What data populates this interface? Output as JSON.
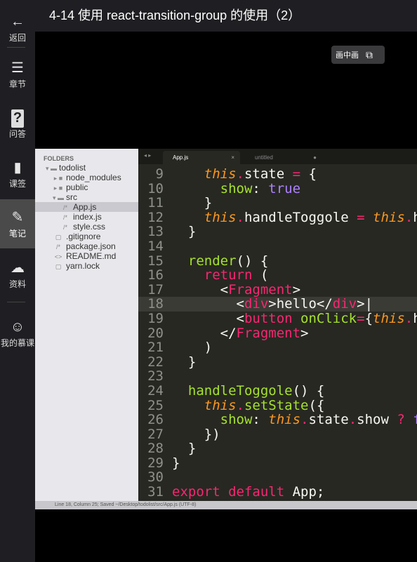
{
  "title": "4-14 使用 react-transition-group 的使用（2）",
  "pip_label": "画中画",
  "sidebar": [
    {
      "label": "返回",
      "icon": "back-arrow-icon",
      "glyph": "←"
    },
    {
      "label": "章节",
      "icon": "menu-icon",
      "glyph": "☰"
    },
    {
      "label": "问答",
      "icon": "question-icon",
      "glyph": "?"
    },
    {
      "label": "课签",
      "icon": "bookmark-icon",
      "glyph": "▮"
    },
    {
      "label": "笔记",
      "icon": "pencil-icon",
      "glyph": "✎"
    },
    {
      "label": "资料",
      "icon": "cloud-download-icon",
      "glyph": "☁"
    },
    {
      "label": "我的慕课",
      "icon": "avatar-icon",
      "glyph": "☺"
    }
  ],
  "editor": {
    "folders_label": "FOLDERS",
    "tree": [
      "todolist",
      "node_modules",
      "public",
      "src",
      "App.js",
      "index.js",
      "style.css",
      ".gitignore",
      "package.json",
      "README.md",
      "yarn.lock"
    ],
    "tabs": [
      "App.js",
      "untitled"
    ],
    "status": "Line 18, Column 25; Saved ~/Desktop/todolist/src/App.js (UTF-8)",
    "lines": [
      {
        "n": "9",
        "s": [
          [
            "p",
            "    "
          ],
          [
            "t",
            "this"
          ],
          [
            "k",
            "."
          ],
          [
            "p",
            "state "
          ],
          [
            "k",
            "="
          ],
          [
            "p",
            " {"
          ]
        ]
      },
      {
        "n": "10",
        "s": [
          [
            "p",
            "      "
          ],
          [
            "f",
            "show"
          ],
          [
            "p",
            ": "
          ],
          [
            "c",
            "true"
          ]
        ]
      },
      {
        "n": "11",
        "s": [
          [
            "p",
            "    }"
          ]
        ]
      },
      {
        "n": "12",
        "s": [
          [
            "p",
            "    "
          ],
          [
            "t",
            "this"
          ],
          [
            "k",
            "."
          ],
          [
            "p",
            "handleToggole "
          ],
          [
            "k",
            "="
          ],
          [
            "p",
            " "
          ],
          [
            "t",
            "this"
          ],
          [
            "k",
            "."
          ],
          [
            "p",
            "h"
          ]
        ]
      },
      {
        "n": "13",
        "s": [
          [
            "p",
            "  }"
          ]
        ]
      },
      {
        "n": "14",
        "s": []
      },
      {
        "n": "15",
        "s": [
          [
            "p",
            "  "
          ],
          [
            "f",
            "render"
          ],
          [
            "p",
            "() {"
          ]
        ]
      },
      {
        "n": "16",
        "s": [
          [
            "p",
            "    "
          ],
          [
            "k",
            "return"
          ],
          [
            "p",
            " ("
          ]
        ]
      },
      {
        "n": "17",
        "s": [
          [
            "p",
            "      <"
          ],
          [
            "k",
            "Fragment"
          ],
          [
            "p",
            ">"
          ]
        ]
      },
      {
        "n": "18",
        "s": [
          [
            "p",
            "        <"
          ],
          [
            "k",
            "div"
          ],
          [
            "p",
            ">hello</"
          ],
          [
            "k",
            "div"
          ],
          [
            "p",
            ">|"
          ]
        ]
      },
      {
        "n": "19",
        "s": [
          [
            "p",
            "        <"
          ],
          [
            "k",
            "button"
          ],
          [
            "p",
            " "
          ],
          [
            "f",
            "onClick"
          ],
          [
            "k",
            "="
          ],
          [
            "p",
            "{"
          ],
          [
            "t",
            "this"
          ],
          [
            "k",
            "."
          ],
          [
            "p",
            "h"
          ]
        ]
      },
      {
        "n": "20",
        "s": [
          [
            "p",
            "      </"
          ],
          [
            "k",
            "Fragment"
          ],
          [
            "p",
            ">"
          ]
        ]
      },
      {
        "n": "21",
        "s": [
          [
            "p",
            "    )"
          ]
        ]
      },
      {
        "n": "22",
        "s": [
          [
            "p",
            "  }"
          ]
        ]
      },
      {
        "n": "23",
        "s": []
      },
      {
        "n": "24",
        "s": [
          [
            "p",
            "  "
          ],
          [
            "f",
            "handleToggole"
          ],
          [
            "p",
            "() {"
          ]
        ]
      },
      {
        "n": "25",
        "s": [
          [
            "p",
            "    "
          ],
          [
            "t",
            "this"
          ],
          [
            "k",
            "."
          ],
          [
            "f",
            "setState"
          ],
          [
            "p",
            "({"
          ]
        ]
      },
      {
        "n": "26",
        "s": [
          [
            "p",
            "      "
          ],
          [
            "f",
            "show"
          ],
          [
            "p",
            ": "
          ],
          [
            "t",
            "this"
          ],
          [
            "k",
            "."
          ],
          [
            "p",
            "state"
          ],
          [
            "k",
            "."
          ],
          [
            "p",
            "show "
          ],
          [
            "k",
            "?"
          ],
          [
            "p",
            " "
          ],
          [
            "c",
            "f"
          ]
        ]
      },
      {
        "n": "27",
        "s": [
          [
            "p",
            "    })"
          ]
        ]
      },
      {
        "n": "28",
        "s": [
          [
            "p",
            "  }"
          ]
        ]
      },
      {
        "n": "29",
        "s": [
          [
            "p",
            "}"
          ]
        ]
      },
      {
        "n": "30",
        "s": []
      },
      {
        "n": "31",
        "s": [
          [
            "k",
            "export"
          ],
          [
            "p",
            " "
          ],
          [
            "k",
            "default"
          ],
          [
            "p",
            " App;"
          ]
        ]
      }
    ]
  }
}
